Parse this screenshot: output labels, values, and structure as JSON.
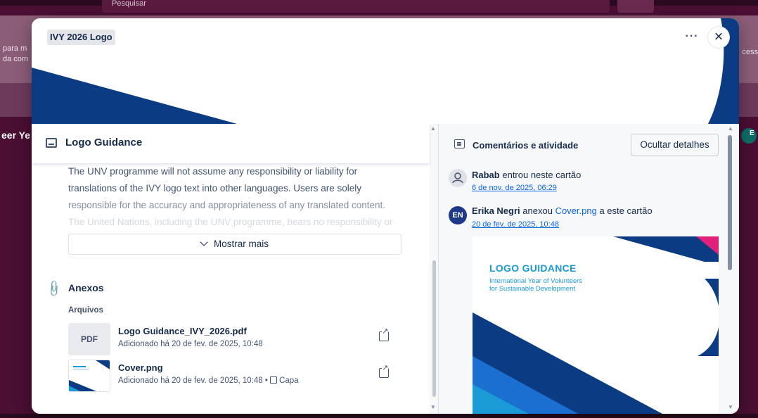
{
  "background": {
    "search_placeholder": "Pesquisar",
    "left_text": [
      "para m",
      "da com"
    ],
    "right_text": "cess",
    "board_title": "eer Ye",
    "right_avatar": "E"
  },
  "modal": {
    "card_title": "IVY 2026 Logo",
    "more_label": "···",
    "close_label": "×",
    "description": {
      "heading": "Logo Guidance",
      "lines": [
        "The UNV programme will not assume any responsibility or liability for",
        "translations of the IVY logo text into other languages. Users are solely",
        "responsible for the accuracy and appropriateness of any translated content.",
        "The United Nations, including the UNV programme, bears no responsibility or"
      ],
      "show_more": "Mostrar mais"
    },
    "attachments": {
      "heading": "Anexos",
      "files_label": "Arquivos",
      "files": [
        {
          "thumb": "PDF",
          "name": "Logo Guidance_IVY_2026.pdf",
          "meta": "Adicionado há 20 de fev. de 2025, 10:48"
        },
        {
          "thumb": "",
          "name": "Cover.png",
          "meta": "Adicionado há 20 de fev. de 2025, 10:48 •",
          "cover_label": "Capa"
        }
      ]
    },
    "activity": {
      "heading": "Comentários e atividade",
      "hide_details": "Ocultar detalhes",
      "items": [
        {
          "user": "Rabab",
          "action": "entrou neste cartão",
          "date": "6 de nov. de 2025, 06:29"
        },
        {
          "avatar": "EN",
          "user": "Erika Negri",
          "action_pre": "anexou",
          "link": "Cover.png",
          "action_post": "a este cartão",
          "date": "20 de fev. de 2025, 10:48"
        }
      ],
      "preview": {
        "title": "LOGO GUIDANCE",
        "subtitle_line1": "International Year of Volunteers",
        "subtitle_line2": "for Sustainable Development"
      }
    }
  },
  "colors": {
    "brand_navy": "#0b3b82",
    "brand_blue": "#1a9bd6",
    "brand_pink": "#e0217c",
    "board_bg": "#4a0f33"
  }
}
